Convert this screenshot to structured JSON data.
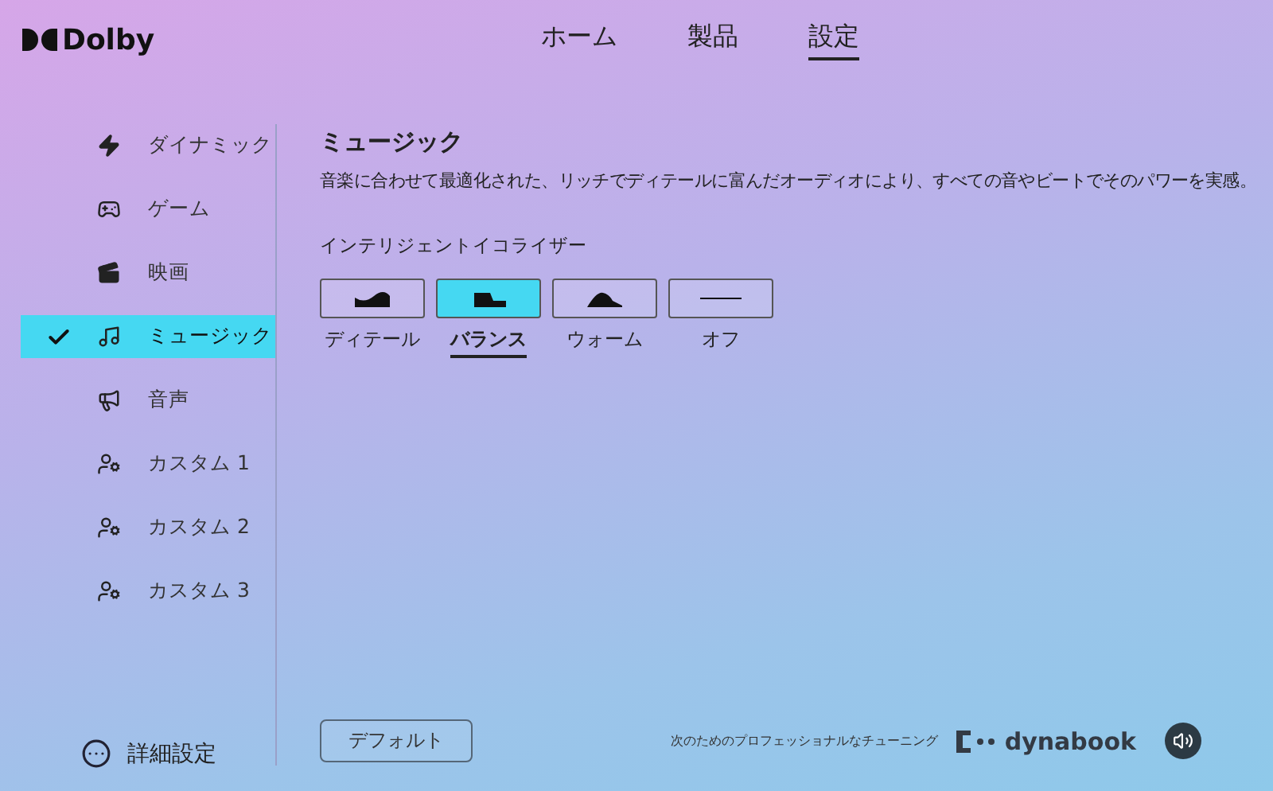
{
  "brand": "Dolby",
  "nav": [
    {
      "label": "ホーム",
      "selected": false
    },
    {
      "label": "製品",
      "selected": false
    },
    {
      "label": "設定",
      "selected": true
    }
  ],
  "sidebar": {
    "items": [
      {
        "label": "ダイナミック",
        "kind": "bolt",
        "selected": false
      },
      {
        "label": "ゲーム",
        "kind": "game",
        "selected": false
      },
      {
        "label": "映画",
        "kind": "film",
        "selected": false
      },
      {
        "label": "ミュージック",
        "kind": "music",
        "selected": true
      },
      {
        "label": "音声",
        "kind": "voice",
        "selected": false
      },
      {
        "label": "カスタム 1",
        "kind": "custom",
        "selected": false
      },
      {
        "label": "カスタム 2",
        "kind": "custom",
        "selected": false
      },
      {
        "label": "カスタム 3",
        "kind": "custom",
        "selected": false
      }
    ],
    "advanced": "詳細設定"
  },
  "content": {
    "title": "ミュージック",
    "description": "音楽に合わせて最適化された、リッチでディテールに富んだオーディオにより、すべての音やビートでそのパワーを実感。",
    "equalizer_label": "インテリジェントイコライザー",
    "presets": [
      {
        "label": "ディテール",
        "kind": "detail",
        "selected": false
      },
      {
        "label": "バランス",
        "kind": "balance",
        "selected": true
      },
      {
        "label": "ウォーム",
        "kind": "warm",
        "selected": false
      },
      {
        "label": "オフ",
        "kind": "off",
        "selected": false
      }
    ],
    "default_button": "デフォルト"
  },
  "footer": {
    "tagline": "次のためのプロフェッショナルなチューニング",
    "partner": "dynabook"
  }
}
